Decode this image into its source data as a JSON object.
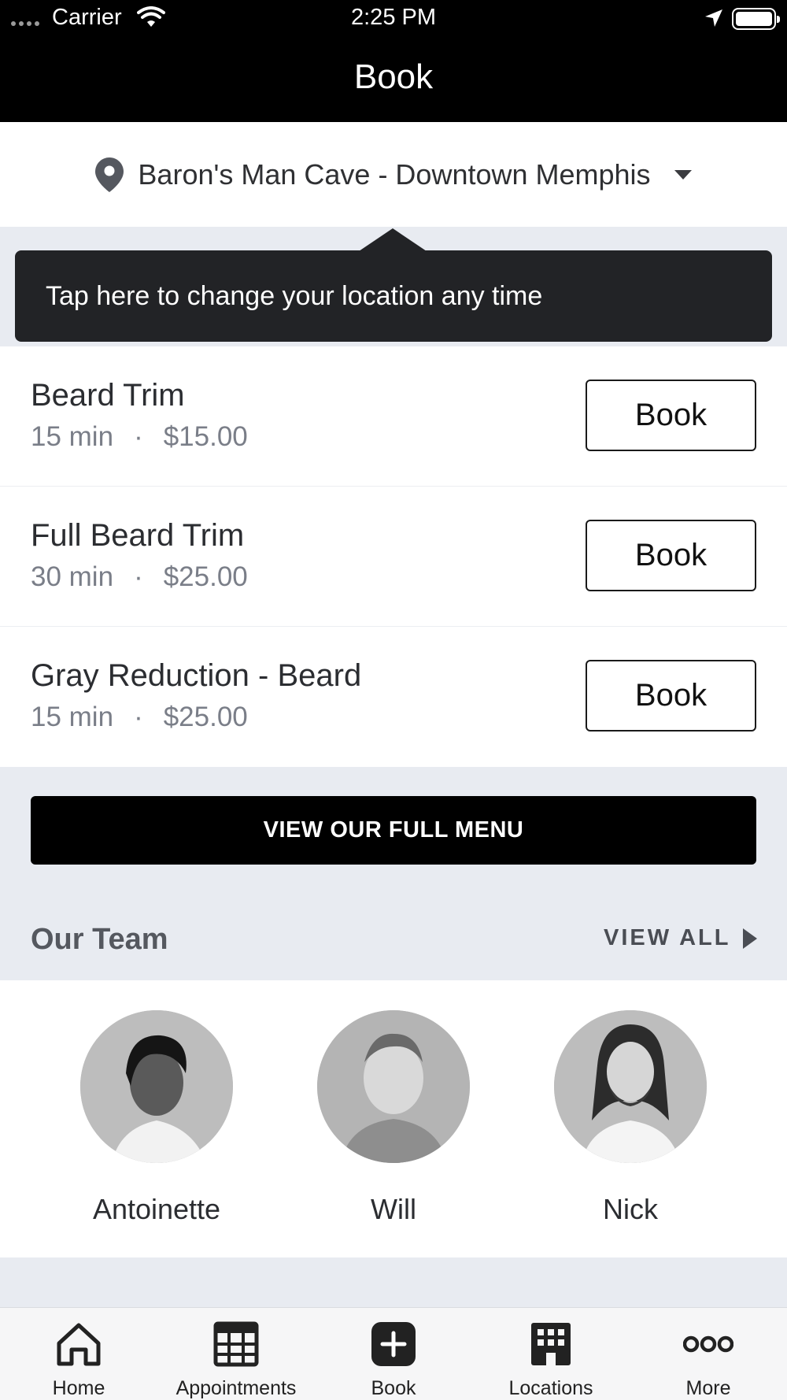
{
  "status_bar": {
    "carrier": "Carrier",
    "time": "2:25 PM"
  },
  "header": {
    "title": "Book"
  },
  "location": {
    "name": "Baron's Man Cave - Downtown Memphis"
  },
  "tooltip": {
    "text": "Tap here to change your location any time"
  },
  "services": [
    {
      "name": "Beard Trim",
      "duration": "15 min",
      "price": "$15.00",
      "button": "Book"
    },
    {
      "name": "Full Beard Trim",
      "duration": "30 min",
      "price": "$25.00",
      "button": "Book"
    },
    {
      "name": "Gray Reduction - Beard",
      "duration": "15 min",
      "price": "$25.00",
      "button": "Book"
    }
  ],
  "meta_separator": "·",
  "full_menu_button": "VIEW OUR FULL MENU",
  "team": {
    "title": "Our Team",
    "view_all": "VIEW ALL",
    "members": [
      {
        "name": "Antoinette"
      },
      {
        "name": "Will"
      },
      {
        "name": "Nick"
      }
    ]
  },
  "tabs": [
    {
      "label": "Home",
      "icon": "home-icon"
    },
    {
      "label": "Appointments",
      "icon": "calendar-icon"
    },
    {
      "label": "Book",
      "icon": "plus-icon"
    },
    {
      "label": "Locations",
      "icon": "building-icon"
    },
    {
      "label": "More",
      "icon": "more-icon"
    }
  ]
}
